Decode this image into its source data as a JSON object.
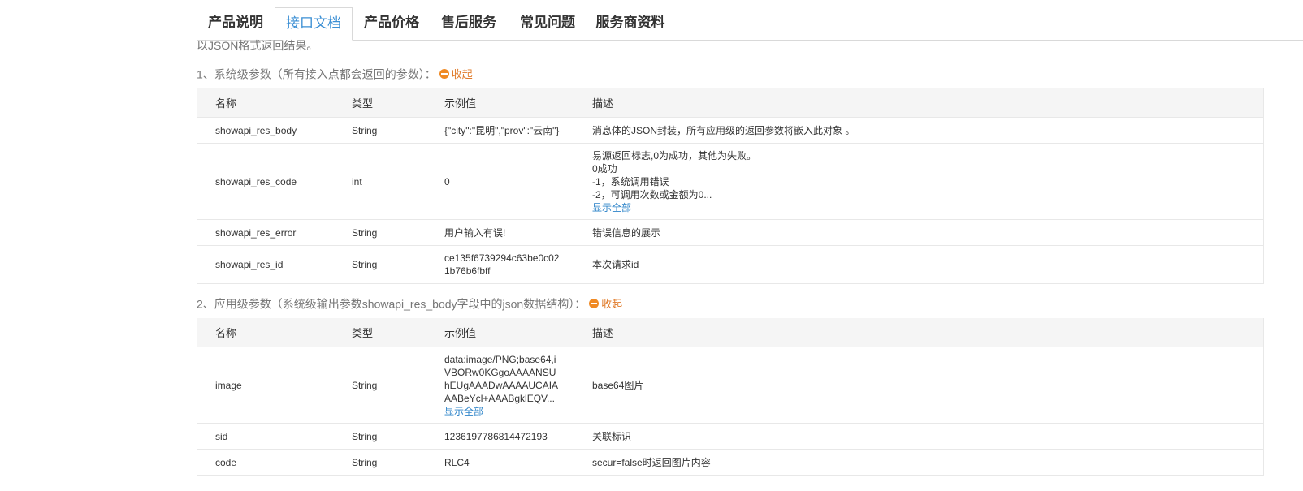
{
  "tabs": [
    {
      "label": "产品说明",
      "active": false
    },
    {
      "label": "接口文档",
      "active": true
    },
    {
      "label": "产品价格",
      "active": false
    },
    {
      "label": "售后服务",
      "active": false
    },
    {
      "label": "常见问题",
      "active": false
    },
    {
      "label": "服务商资料",
      "active": false
    }
  ],
  "intro": "以JSON格式返回结果。",
  "collapse_label": "收起",
  "show_all_label": "显示全部",
  "section1": {
    "title": "1、系统级参数（所有接入点都会返回的参数）：",
    "headers": [
      "名称",
      "类型",
      "示例值",
      "描述"
    ],
    "rows": [
      {
        "name": "showapi_res_body",
        "type": "String",
        "example": "{\"city\":\"昆明\",\"prov\":\"云南\"}",
        "desc": "消息体的JSON封装，所有应用级的返回参数将嵌入此对象 。"
      },
      {
        "name": "showapi_res_code",
        "type": "int",
        "example": "0",
        "desc_lines": [
          "易源返回标志,0为成功，其他为失败。",
          "0成功",
          "-1，系统调用错误",
          "-2，可调用次数或金额为0..."
        ]
      },
      {
        "name": "showapi_res_error",
        "type": "String",
        "example": "用户输入有误!",
        "desc": "错误信息的展示"
      },
      {
        "name": "showapi_res_id",
        "type": "String",
        "example_lines": [
          "ce135f6739294c63be0c02",
          "1b76b6fbff"
        ],
        "desc": "本次请求id"
      }
    ]
  },
  "section2": {
    "title": "2、应用级参数（系统级输出参数showapi_res_body字段中的json数据结构）：",
    "headers": [
      "名称",
      "类型",
      "示例值",
      "描述"
    ],
    "rows": [
      {
        "name": "image",
        "type": "String",
        "example_lines": [
          "data:image/PNG;base64,i",
          "VBORw0KGgoAAAANSU",
          "hEUgAAADwAAAAUCAIA",
          "AABeYcl+AAABgklEQV..."
        ],
        "desc": "base64图片"
      },
      {
        "name": "sid",
        "type": "String",
        "example": "1236197786814472193",
        "desc": "关联标识"
      },
      {
        "name": "code",
        "type": "String",
        "example": "RLC4",
        "desc": "secur=false时返回图片内容"
      }
    ]
  }
}
